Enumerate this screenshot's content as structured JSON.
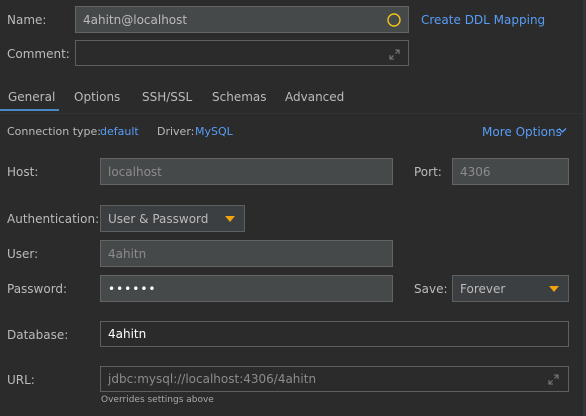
{
  "name": {
    "label": "Name:",
    "value": "4ahitn@localhost",
    "ddl_link": "Create DDL Mapping"
  },
  "comment": {
    "label": "Comment:",
    "value": ""
  },
  "tabs": [
    {
      "label": "General",
      "active": true
    },
    {
      "label": "Options"
    },
    {
      "label": "SSH/SSL"
    },
    {
      "label": "Schemas"
    },
    {
      "label": "Advanced"
    }
  ],
  "connection": {
    "type_label": "Connection type:",
    "type_value": "default",
    "driver_label": "Driver:",
    "driver_value": "MySQL",
    "more_options": "More Options"
  },
  "host": {
    "label": "Host:",
    "value": "localhost"
  },
  "port": {
    "label": "Port:",
    "value": "4306"
  },
  "auth": {
    "label": "Authentication:",
    "value": "User & Password"
  },
  "user": {
    "label": "User:",
    "value": "4ahitn"
  },
  "password": {
    "label": "Password:",
    "value": "••••••"
  },
  "save": {
    "label": "Save:",
    "value": "Forever"
  },
  "database": {
    "label": "Database:",
    "value": "4ahitn"
  },
  "url": {
    "label": "URL:",
    "value": "jdbc:mysql://localhost:4306/4ahitn",
    "hint": "Overrides settings above"
  },
  "colors": {
    "background": "#2b2b2b",
    "field_bg": "#45494a",
    "link": "#589df6",
    "accent_orange": "#f0a30a",
    "tab_underline": "#4a88c7"
  },
  "icons": [
    "circle-status-icon",
    "expand-icon",
    "chevron-down-icon",
    "dropdown-caret-icon"
  ]
}
